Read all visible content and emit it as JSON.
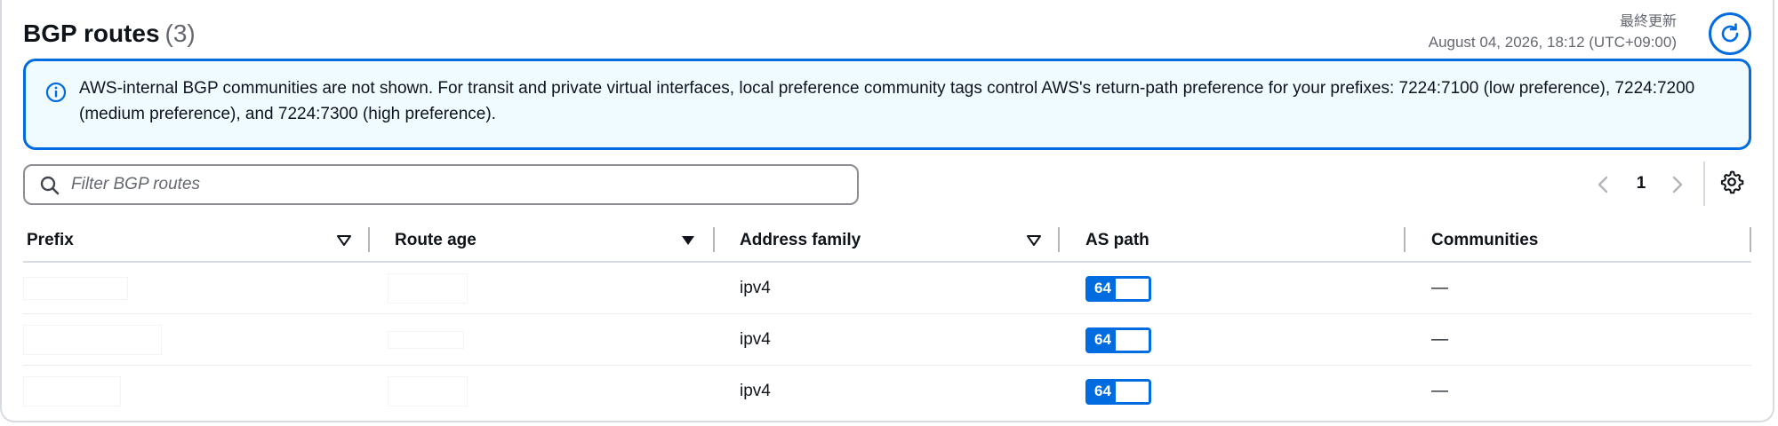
{
  "header": {
    "title": "BGP routes",
    "count": "(3)",
    "last_updated_label": "最終更新",
    "last_updated_value": "August 04, 2026, 18:12 (UTC+09:00)",
    "refresh_icon": "refresh-icon"
  },
  "alert": {
    "icon": "info-icon",
    "text": "AWS-internal BGP communities are not shown. For transit and private virtual interfaces, local preference community tags control AWS's return-path preference for your prefixes: 7224:7100 (low preference), 7224:7200 (medium preference), and 7224:7300 (high preference)."
  },
  "filter": {
    "placeholder": "Filter BGP routes",
    "value": ""
  },
  "pagination": {
    "current_page": "1"
  },
  "table": {
    "columns": [
      "Prefix",
      "Route age",
      "Address family",
      "AS path",
      "Communities"
    ],
    "rows": [
      {
        "prefix": "",
        "route_age": "",
        "address_family": "ipv4",
        "as_path": "64",
        "communities": "—"
      },
      {
        "prefix": "",
        "route_age": "",
        "address_family": "ipv4",
        "as_path": "64",
        "communities": "—"
      },
      {
        "prefix": "",
        "route_age": "",
        "address_family": "ipv4",
        "as_path": "64",
        "communities": "—"
      }
    ]
  },
  "colors": {
    "accent": "#006ce0",
    "alert_bg": "#f0fbff",
    "border": "#d5dbe1",
    "muted_text": "#656871"
  }
}
